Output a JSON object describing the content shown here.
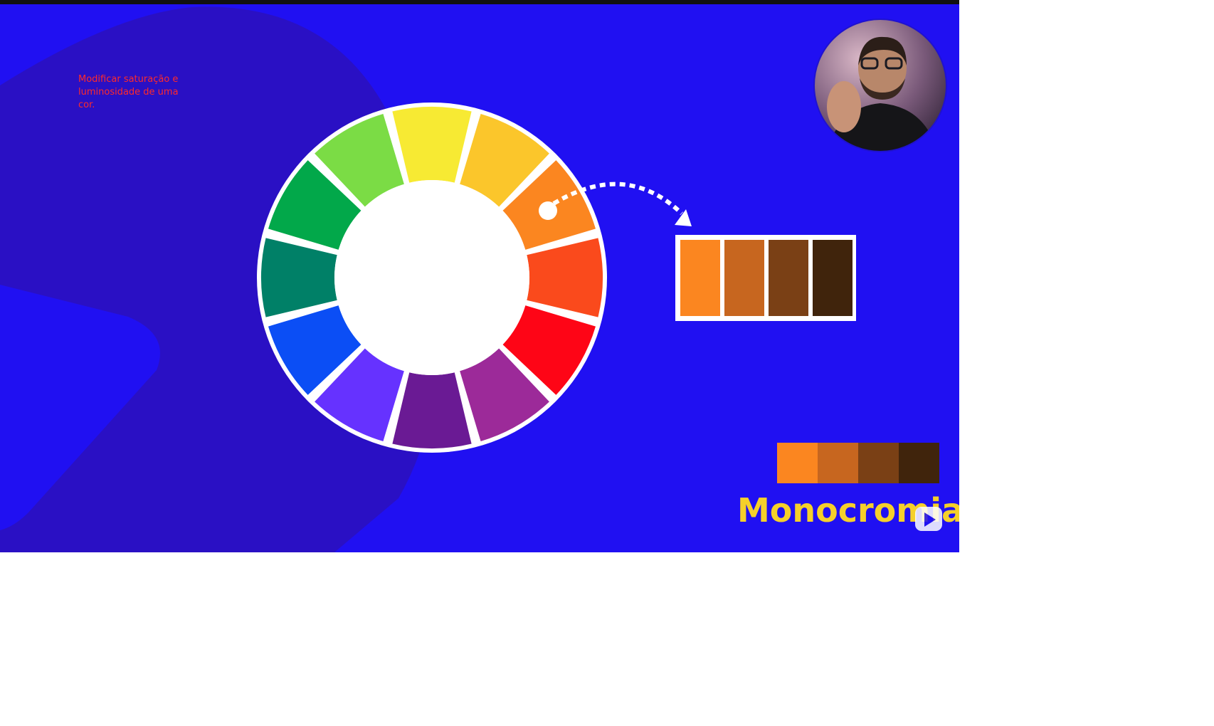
{
  "annotation": {
    "text": "Modificar saturação e luminosidade de uma cor."
  },
  "slide": {
    "title": "Monocromia",
    "background_color": "#2010f2",
    "shape_color": "#2a10c4",
    "title_color": "#f5d02a"
  },
  "color_wheel": {
    "selected_segment_index": 2,
    "segments": [
      {
        "name": "yellow",
        "color": "#f7ea33"
      },
      {
        "name": "yellow-orange",
        "color": "#fbc62b"
      },
      {
        "name": "orange",
        "color": "#fb8620"
      },
      {
        "name": "red-orange",
        "color": "#fa4a1c"
      },
      {
        "name": "red",
        "color": "#fe0516"
      },
      {
        "name": "red-violet",
        "color": "#9c2a99"
      },
      {
        "name": "violet",
        "color": "#6a1a94"
      },
      {
        "name": "blue-violet",
        "color": "#6632ff"
      },
      {
        "name": "blue",
        "color": "#0b4ef5"
      },
      {
        "name": "blue-green",
        "color": "#008067"
      },
      {
        "name": "green",
        "color": "#02a84a"
      },
      {
        "name": "yellow-green",
        "color": "#7bdc45"
      }
    ]
  },
  "palette_framed": [
    "#fb8620",
    "#c7661f",
    "#7a4015",
    "#40240c"
  ],
  "palette_strip": [
    "#fb8620",
    "#c7661f",
    "#7a4015",
    "#40240c"
  ],
  "icons": {
    "presenter": "presenter-video-icon",
    "logo": "play-logo-icon",
    "arrow": "dotted-arrow-icon"
  }
}
